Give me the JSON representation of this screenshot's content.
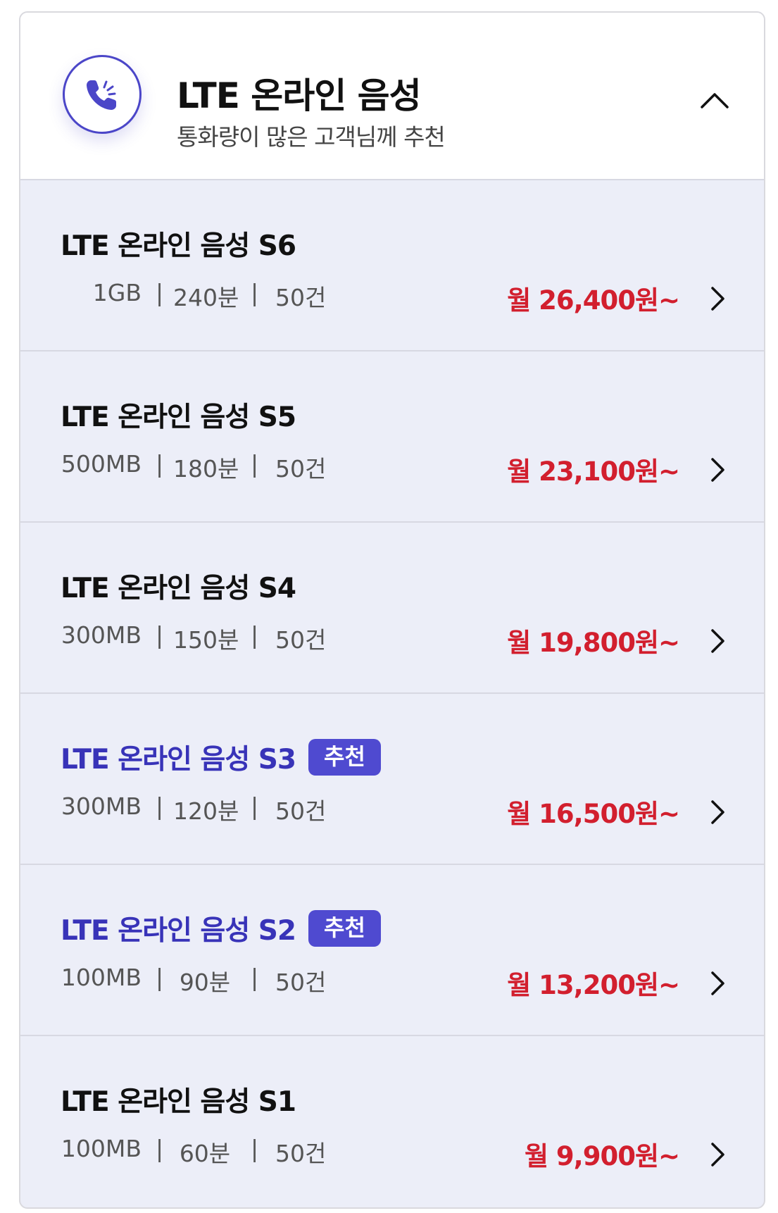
{
  "header": {
    "title": "LTE 온라인 음성",
    "subtitle": "통화량이 많은 고객님께 추천",
    "icon": "phone-ringing-icon",
    "toggle_icon": "chevron-up-icon"
  },
  "colors": {
    "accent": "#4b46c8",
    "price": "#d21f2e",
    "recommended_name": "#3833b8",
    "row_background": "#eceef8"
  },
  "plans": [
    {
      "name": "LTE 온라인 음성 S6",
      "data": "1GB",
      "voice": "240분",
      "sms": "50건",
      "price": "월 26,400원~",
      "badge": ""
    },
    {
      "name": "LTE 온라인 음성 S5",
      "data": "500MB",
      "voice": "180분",
      "sms": "50건",
      "price": "월 23,100원~",
      "badge": ""
    },
    {
      "name": "LTE 온라인 음성 S4",
      "data": "300MB",
      "voice": "150분",
      "sms": "50건",
      "price": "월 19,800원~",
      "badge": ""
    },
    {
      "name": "LTE 온라인 음성 S3",
      "data": "300MB",
      "voice": "120분",
      "sms": "50건",
      "price": "월 16,500원~",
      "badge": "추천"
    },
    {
      "name": "LTE 온라인 음성 S2",
      "data": "100MB",
      "voice": "90분",
      "sms": "50건",
      "price": "월 13,200원~",
      "badge": "추천"
    },
    {
      "name": "LTE 온라인 음성 S1",
      "data": "100MB",
      "voice": "60분",
      "sms": "50건",
      "price": "월 9,900원~",
      "badge": ""
    }
  ],
  "separator": "|"
}
